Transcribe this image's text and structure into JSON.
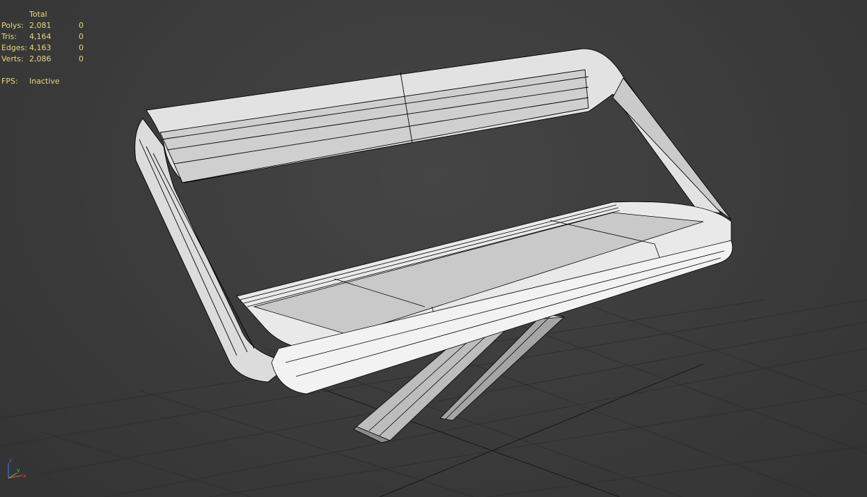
{
  "viewport": {
    "background": "#3a3a3a",
    "grid_color": "#2e2e2e",
    "text_color": "#e8d87a"
  },
  "stats": {
    "header": "Total",
    "rows": [
      {
        "label": "Polys:",
        "total": "2,081",
        "selected": "0"
      },
      {
        "label": "Tris:",
        "total": "4,164",
        "selected": "0"
      },
      {
        "label": "Edges:",
        "total": "4,163",
        "selected": "0"
      },
      {
        "label": "Verts:",
        "total": "2,086",
        "selected": "0"
      }
    ],
    "fps_label": "FPS:",
    "fps_value": "Inactive"
  },
  "axis_gizmo": {
    "x": "x",
    "y": "y",
    "z": "z",
    "x_color": "#e04040",
    "y_color": "#40c040",
    "z_color": "#4a6fe0"
  },
  "model": {
    "name": "bench-wireframe",
    "shade": "#d8d8d8",
    "wire": "#000000"
  }
}
